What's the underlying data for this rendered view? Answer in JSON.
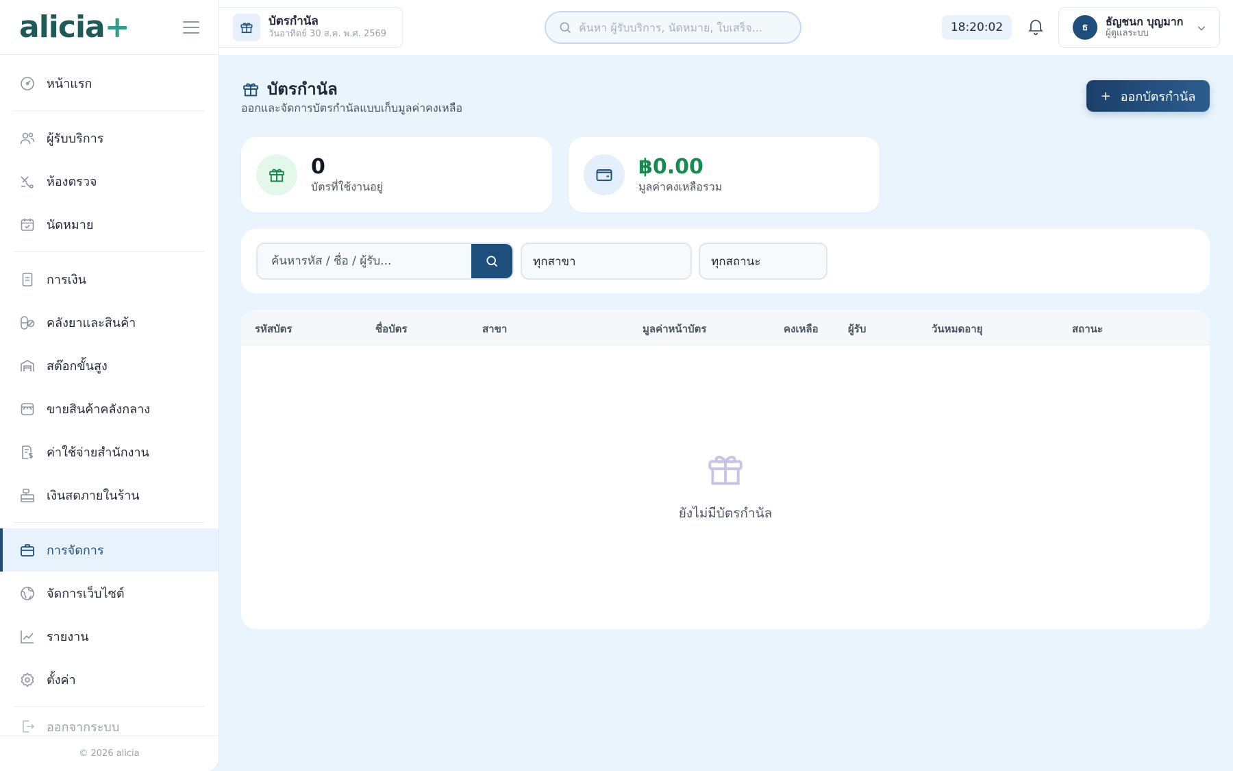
{
  "brand": {
    "name": "alicia",
    "plus": "+"
  },
  "topbar": {
    "page_title": "บัตรกำนัล",
    "page_date": "วันอาทิตย์ 30 ส.ค. พ.ศ. 2569",
    "search_placeholder": "ค้นหา ผู้รับบริการ, นัดหมาย, ใบเสร็จ...",
    "clock": "18:20:02",
    "user": {
      "initial": "ธ",
      "name": "ธัญชนก บุญมาก",
      "role": "ผู้ดูแลระบบ"
    }
  },
  "sidebar": {
    "items": [
      {
        "label": "หน้าแรก",
        "icon": "dashboard-icon"
      },
      {
        "label": "ผู้รับบริการ",
        "icon": "users-icon"
      },
      {
        "label": "ห้องตรวจ",
        "icon": "stethoscope-icon"
      },
      {
        "label": "นัดหมาย",
        "icon": "calendar-check-icon"
      },
      {
        "label": "การเงิน",
        "icon": "receipt-icon"
      },
      {
        "label": "คลังยาและสินค้า",
        "icon": "pill-icon"
      },
      {
        "label": "สต๊อกขั้นสูง",
        "icon": "warehouse-icon"
      },
      {
        "label": "ขายสินค้าคลังกลาง",
        "icon": "store-icon"
      },
      {
        "label": "ค่าใช้จ่ายสำนักงาน",
        "icon": "expense-icon"
      },
      {
        "label": "เงินสดภายในร้าน",
        "icon": "cash-register-icon"
      },
      {
        "label": "การจัดการ",
        "icon": "briefcase-icon",
        "active": true
      },
      {
        "label": "จัดการเว็บไซต์",
        "icon": "globe-icon"
      },
      {
        "label": "รายงาน",
        "icon": "chart-line-icon"
      },
      {
        "label": "ตั้งค่า",
        "icon": "gear-icon"
      }
    ],
    "logout": "ออกจากระบบ",
    "footer": "© 2026 alicia"
  },
  "page": {
    "title": "บัตรกำนัล",
    "subtitle": "ออกและจัดการบัตรกำนัลแบบเก็บมูลค่าคงเหลือ",
    "issue_button": "ออกบัตรกำนัล"
  },
  "stats": {
    "active": {
      "value": "0",
      "label": "บัตรที่ใช้งานอยู่"
    },
    "balance": {
      "value": "฿0.00",
      "label": "มูลค่าคงเหลือรวม"
    }
  },
  "filters": {
    "search_placeholder": "ค้นหารหัส / ชื่อ / ผู้รับ...",
    "branch": "ทุกสาขา",
    "status": "ทุกสถานะ"
  },
  "table": {
    "columns": [
      "รหัสบัตร",
      "ชื่อบัตร",
      "สาขา",
      "มูลค่าหน้าบัตร",
      "คงเหลือ",
      "ผู้รับ",
      "วันหมดอายุ",
      "สถานะ"
    ],
    "empty_text": "ยังไม่มีบัตรกำนัล"
  },
  "colors": {
    "accent": "#1e4e7c",
    "success": "#178a50",
    "page_bg": "#eaf4fd"
  }
}
